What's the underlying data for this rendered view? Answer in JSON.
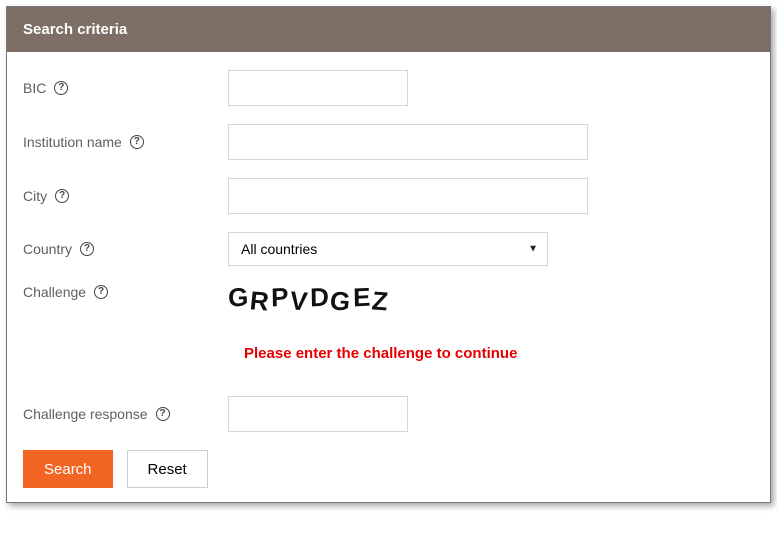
{
  "header": {
    "title": "Search criteria"
  },
  "fields": {
    "bic": {
      "label": "BIC",
      "value": ""
    },
    "institution": {
      "label": "Institution name",
      "value": ""
    },
    "city": {
      "label": "City",
      "value": ""
    },
    "country": {
      "label": "Country",
      "selected": "All countries"
    },
    "challenge": {
      "label": "Challenge",
      "captcha": "GRPVDGEZ"
    },
    "challenge_response": {
      "label": "Challenge response",
      "value": ""
    }
  },
  "messages": {
    "challenge_error": "Please enter the challenge to continue"
  },
  "buttons": {
    "search": "Search",
    "reset": "Reset"
  }
}
